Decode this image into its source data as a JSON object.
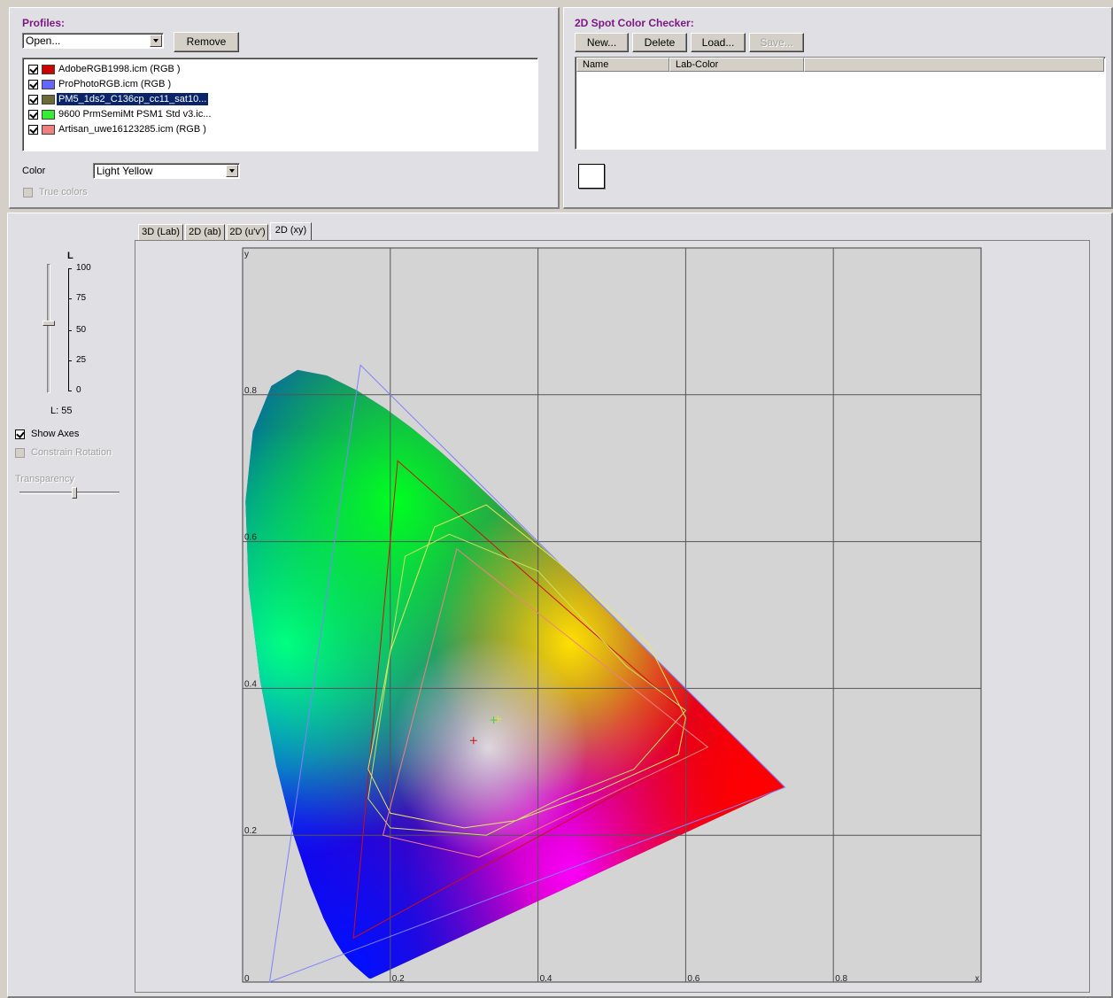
{
  "profiles_panel": {
    "title": "Profiles:",
    "open_combo_value": "Open...",
    "remove_label": "Remove",
    "items": [
      {
        "label": "AdobeRGB1998.icm (RGB )",
        "color": "#cc0000",
        "checked": true,
        "selected": false
      },
      {
        "label": "ProPhotoRGB.icm (RGB )",
        "color": "#6666ff",
        "checked": true,
        "selected": false
      },
      {
        "label": "PM5_1ds2_C136cp_cc11_sat10...",
        "color": "#6b6b3a",
        "checked": true,
        "selected": true
      },
      {
        "label": "9600 PrmSemiMt PSM1 Std v3.ic...",
        "color": "#33ee33",
        "checked": true,
        "selected": false
      },
      {
        "label": "Artisan_uwe16123285.icm (RGB )",
        "color": "#f08080",
        "checked": true,
        "selected": false
      }
    ],
    "color_label": "Color",
    "color_value": "Light Yellow",
    "true_colors_label": "True colors"
  },
  "spot_panel": {
    "title": "2D Spot Color Checker:",
    "new_label": "New...",
    "delete_label": "Delete",
    "load_label": "Load...",
    "save_label": "Save...",
    "columns": [
      "Name",
      "Lab-Color"
    ],
    "swatch_color": "#ffffff"
  },
  "left_controls": {
    "slider_title": "L",
    "slider_ticks": [
      "100",
      "75",
      "50",
      "25",
      "0"
    ],
    "l_readout": "L: 55",
    "l_value": 55,
    "show_axes_label": "Show Axes",
    "constrain_rotation_label": "Constrain Rotation",
    "transparency_label": "Transparency",
    "transparency_value": 0.55
  },
  "tabs": [
    {
      "label": "3D (Lab)",
      "active": false
    },
    {
      "label": "2D (ab)",
      "active": false
    },
    {
      "label": "2D (u'v')",
      "active": false
    },
    {
      "label": "2D (xy)",
      "active": true
    }
  ],
  "chart_data": {
    "type": "scatter",
    "xlabel": "x",
    "ylabel": "y",
    "xlim": [
      0,
      1
    ],
    "ylim": [
      0,
      1
    ],
    "x_ticks": [
      "0",
      "0.2",
      "0.4",
      "0.6",
      "0.8"
    ],
    "y_ticks": [
      "0.2",
      "0.4",
      "0.6",
      "0.8"
    ],
    "grid": true,
    "gamuts": [
      {
        "color": "#cc1010",
        "points": [
          [
            0.64,
            0.33
          ],
          [
            0.21,
            0.71
          ],
          [
            0.15,
            0.06
          ]
        ]
      },
      {
        "color": "#8080ff",
        "points": [
          [
            0.7347,
            0.2653
          ],
          [
            0.1596,
            0.8404
          ],
          [
            0.0366,
            0.0001
          ]
        ]
      },
      {
        "color": "#e8e860",
        "points": [
          [
            0.33,
            0.65
          ],
          [
            0.43,
            0.57
          ],
          [
            0.55,
            0.46
          ],
          [
            0.6,
            0.36
          ],
          [
            0.59,
            0.31
          ],
          [
            0.48,
            0.26
          ],
          [
            0.37,
            0.22
          ],
          [
            0.3,
            0.21
          ],
          [
            0.2,
            0.23
          ],
          [
            0.17,
            0.29
          ],
          [
            0.2,
            0.45
          ],
          [
            0.26,
            0.62
          ]
        ]
      },
      {
        "color": "#d0e060",
        "points": [
          [
            0.28,
            0.61
          ],
          [
            0.4,
            0.56
          ],
          [
            0.52,
            0.43
          ],
          [
            0.6,
            0.37
          ],
          [
            0.53,
            0.29
          ],
          [
            0.43,
            0.25
          ],
          [
            0.33,
            0.2
          ],
          [
            0.2,
            0.21
          ],
          [
            0.17,
            0.25
          ],
          [
            0.2,
            0.45
          ],
          [
            0.22,
            0.58
          ]
        ]
      },
      {
        "color": "#f08080",
        "points": [
          [
            0.29,
            0.59
          ],
          [
            0.63,
            0.32
          ],
          [
            0.32,
            0.17
          ],
          [
            0.19,
            0.2
          ]
        ]
      }
    ],
    "white_points": [
      {
        "x": 0.3127,
        "y": 0.329,
        "color": "#cc1010"
      },
      {
        "x": 0.3457,
        "y": 0.3585,
        "color": "#e0e040"
      },
      {
        "x": 0.34,
        "y": 0.357,
        "color": "#40d040"
      }
    ]
  }
}
